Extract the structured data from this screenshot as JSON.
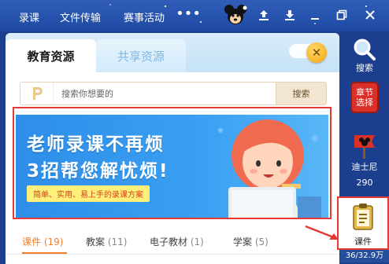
{
  "topbar": {
    "menu": [
      "录课",
      "文件传输",
      "赛事活动"
    ],
    "more_icon": "more-dots-icon",
    "mascot_icon": "mickey-icon",
    "buttons": [
      "share-icon",
      "download-icon",
      "restore-window-icon",
      "close-icon"
    ]
  },
  "panel": {
    "tabs": [
      {
        "label": "教育资源",
        "active": true
      },
      {
        "label": "共享资源",
        "active": false
      }
    ],
    "close_icon": "close-icon",
    "search": {
      "placeholder": "搜索你想要的",
      "button_label": "搜索"
    },
    "banner": {
      "title_line1": "老师录课不再烦",
      "title_line2": "3招帮您解忧烦!",
      "subtitle": "简单、实用、易上手的录课方案"
    },
    "bottom_tabs": [
      {
        "label": "课件",
        "count": "(19)",
        "active": true
      },
      {
        "label": "教案",
        "count": "(11)",
        "active": false
      },
      {
        "label": "电子教材",
        "count": "(1)",
        "active": false
      },
      {
        "label": "学案",
        "count": "(5)",
        "active": false
      }
    ]
  },
  "sidebar": {
    "search_label": "搜索",
    "chapter_line1": "章节",
    "chapter_line2": "选择",
    "disney_label": "迪士尼",
    "disney_count": "290",
    "courseware_label": "课件",
    "storage": "36/32.9万"
  },
  "colors": {
    "topbar": "#2f5db8",
    "highlight_border": "#e53935",
    "active_tab": "#f07f2c",
    "banner": "#3aa0f3"
  }
}
